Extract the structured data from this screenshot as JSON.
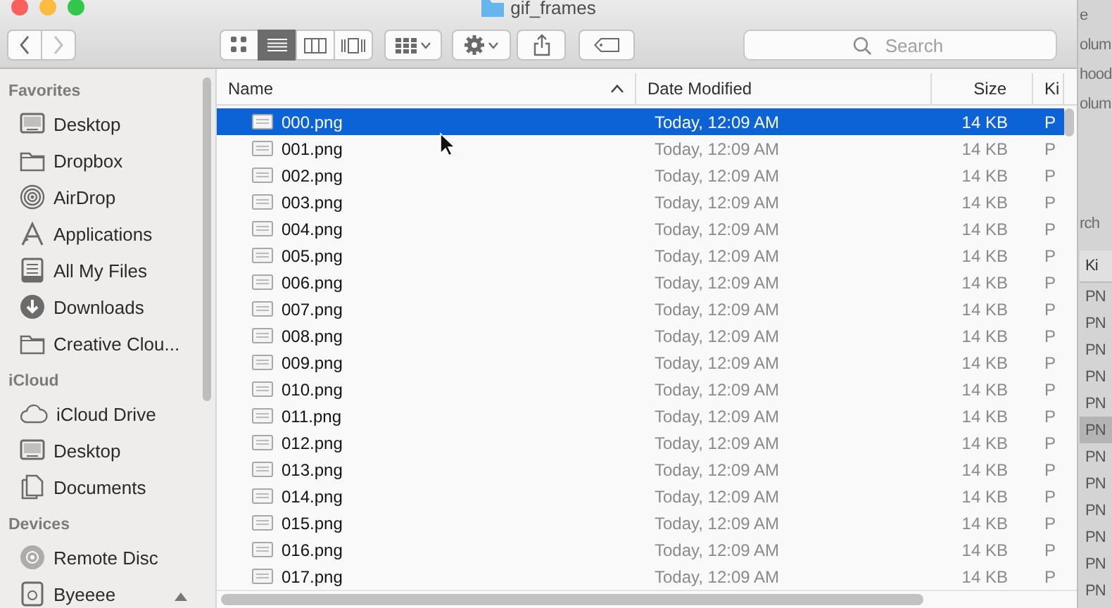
{
  "window": {
    "title": "gif_frames"
  },
  "toolbar": {
    "back": {
      "disabled": false
    },
    "forward": {
      "disabled": true
    },
    "view_modes": [
      {
        "kind": "icons",
        "selected": false
      },
      {
        "kind": "list",
        "selected": true
      },
      {
        "kind": "columns",
        "selected": false
      },
      {
        "kind": "coverflow",
        "selected": false
      }
    ],
    "search": {
      "placeholder": "Search"
    }
  },
  "sidebar": {
    "sections": [
      {
        "title": "Favorites",
        "items": [
          {
            "label": "Desktop",
            "kind": "desktop"
          },
          {
            "label": "Dropbox",
            "kind": "folder"
          },
          {
            "label": "AirDrop",
            "kind": "airdrop"
          },
          {
            "label": "Applications",
            "kind": "apps"
          },
          {
            "label": "All My Files",
            "kind": "files"
          },
          {
            "label": "Downloads",
            "kind": "downloads"
          },
          {
            "label": "Creative Clou...",
            "kind": "folder"
          }
        ]
      },
      {
        "title": "iCloud",
        "items": [
          {
            "label": "iCloud Drive",
            "kind": "cloud"
          },
          {
            "label": "Desktop",
            "kind": "desktop"
          },
          {
            "label": "Documents",
            "kind": "documents"
          }
        ]
      },
      {
        "title": "Devices",
        "items": [
          {
            "label": "Remote Disc",
            "kind": "disc"
          },
          {
            "label": "Byeeee",
            "kind": "drive"
          }
        ]
      }
    ]
  },
  "table": {
    "columns": [
      {
        "label": "Name",
        "sorted": true
      },
      {
        "label": "Date Modified",
        "sorted": false
      },
      {
        "label": "Size",
        "sorted": false
      },
      {
        "label": "Ki",
        "sorted": false
      }
    ],
    "rows": [
      {
        "name": "000.png",
        "date": "Today, 12:09 AM",
        "size": "14 KB",
        "kind": "P",
        "selected": true
      },
      {
        "name": "001.png",
        "date": "Today, 12:09 AM",
        "size": "14 KB",
        "kind": "P",
        "selected": false
      },
      {
        "name": "002.png",
        "date": "Today, 12:09 AM",
        "size": "14 KB",
        "kind": "P",
        "selected": false
      },
      {
        "name": "003.png",
        "date": "Today, 12:09 AM",
        "size": "14 KB",
        "kind": "P",
        "selected": false
      },
      {
        "name": "004.png",
        "date": "Today, 12:09 AM",
        "size": "14 KB",
        "kind": "P",
        "selected": false
      },
      {
        "name": "005.png",
        "date": "Today, 12:09 AM",
        "size": "14 KB",
        "kind": "P",
        "selected": false
      },
      {
        "name": "006.png",
        "date": "Today, 12:09 AM",
        "size": "14 KB",
        "kind": "P",
        "selected": false
      },
      {
        "name": "007.png",
        "date": "Today, 12:09 AM",
        "size": "14 KB",
        "kind": "P",
        "selected": false
      },
      {
        "name": "008.png",
        "date": "Today, 12:09 AM",
        "size": "14 KB",
        "kind": "P",
        "selected": false
      },
      {
        "name": "009.png",
        "date": "Today, 12:09 AM",
        "size": "14 KB",
        "kind": "P",
        "selected": false
      },
      {
        "name": "010.png",
        "date": "Today, 12:09 AM",
        "size": "14 KB",
        "kind": "P",
        "selected": false
      },
      {
        "name": "011.png",
        "date": "Today, 12:09 AM",
        "size": "14 KB",
        "kind": "P",
        "selected": false
      },
      {
        "name": "012.png",
        "date": "Today, 12:09 AM",
        "size": "14 KB",
        "kind": "P",
        "selected": false
      },
      {
        "name": "013.png",
        "date": "Today, 12:09 AM",
        "size": "14 KB",
        "kind": "P",
        "selected": false
      },
      {
        "name": "014.png",
        "date": "Today, 12:09 AM",
        "size": "14 KB",
        "kind": "P",
        "selected": false
      },
      {
        "name": "015.png",
        "date": "Today, 12:09 AM",
        "size": "14 KB",
        "kind": "P",
        "selected": false
      },
      {
        "name": "016.png",
        "date": "Today, 12:09 AM",
        "size": "14 KB",
        "kind": "P",
        "selected": false
      },
      {
        "name": "017.png",
        "date": "Today, 12:09 AM",
        "size": "14 KB",
        "kind": "P",
        "selected": false
      }
    ]
  },
  "background_window": {
    "toolbar_texts": [
      "e",
      "olum",
      "hood",
      "olum"
    ],
    "search_text": "rch",
    "column_header": "Ki",
    "rows": [
      {
        "kind": "PN",
        "selected": false
      },
      {
        "kind": "PN",
        "selected": false
      },
      {
        "kind": "PN",
        "selected": false
      },
      {
        "kind": "PN",
        "selected": false
      },
      {
        "kind": "PN",
        "selected": false
      },
      {
        "kind": "PN",
        "selected": true
      },
      {
        "kind": "PN",
        "selected": false
      },
      {
        "kind": "PN",
        "selected": false
      },
      {
        "kind": "PN",
        "selected": false
      },
      {
        "kind": "PN",
        "selected": false
      },
      {
        "kind": "PN",
        "selected": false
      },
      {
        "kind": "PN",
        "selected": false
      }
    ]
  }
}
